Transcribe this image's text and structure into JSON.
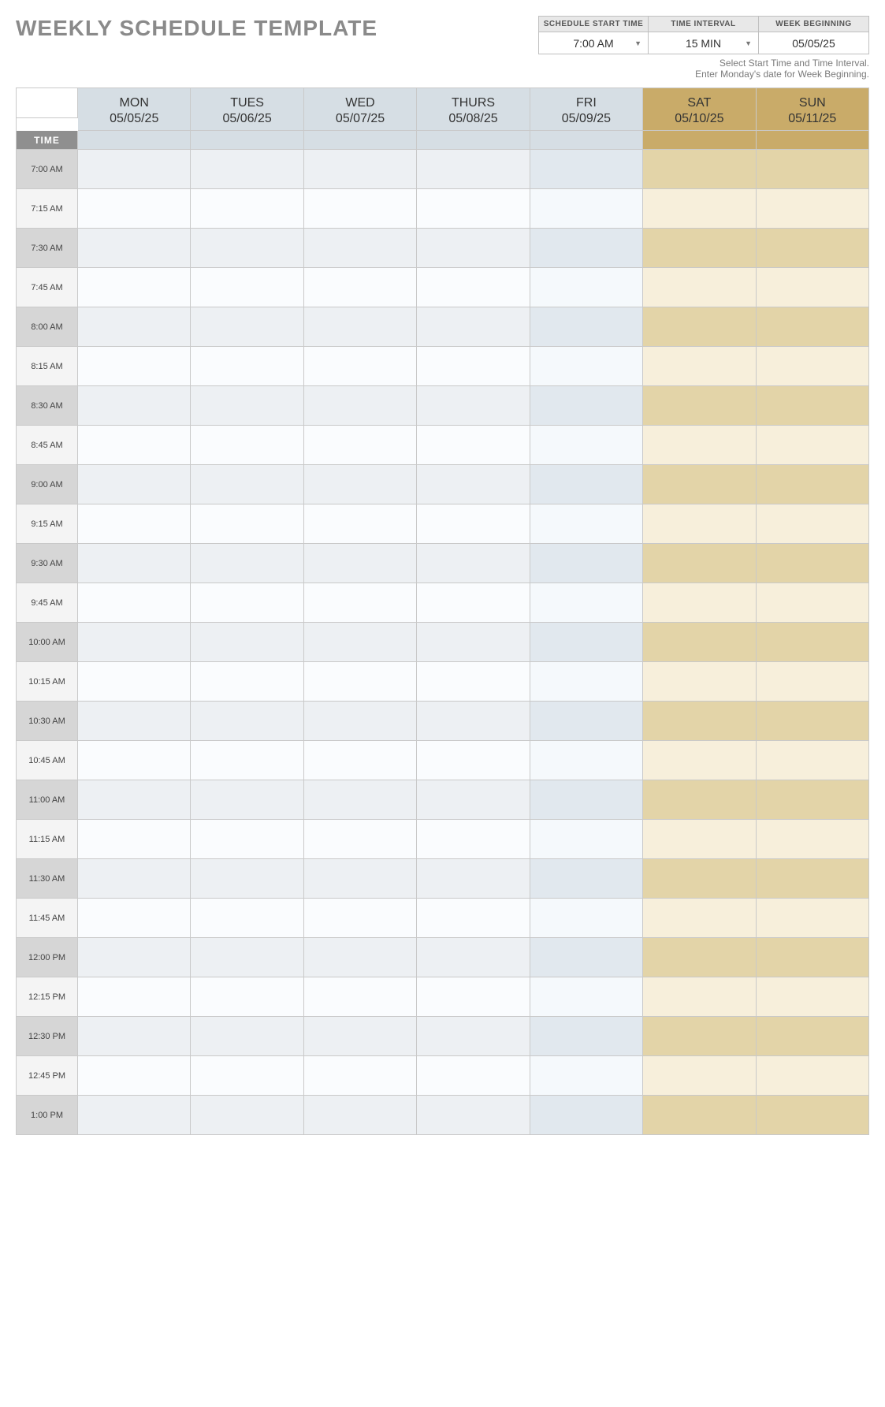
{
  "title": "WEEKLY SCHEDULE TEMPLATE",
  "subtitle_line1": "Select Start Time and Time Interval.",
  "subtitle_line2": "Enter Monday's date for Week Beginning.",
  "controls": {
    "start_time": {
      "label": "SCHEDULE START TIME",
      "value": "7:00 AM",
      "dropdown": true
    },
    "time_interval": {
      "label": "TIME INTERVAL",
      "value": "15 MIN",
      "dropdown": true
    },
    "week_begin": {
      "label": "WEEK BEGINNING",
      "value": "05/05/25",
      "dropdown": false
    }
  },
  "time_header_label": "TIME",
  "days": [
    {
      "name": "MON",
      "date": "05/05/25",
      "weekend": false,
      "friday": false
    },
    {
      "name": "TUES",
      "date": "05/06/25",
      "weekend": false,
      "friday": false
    },
    {
      "name": "WED",
      "date": "05/07/25",
      "weekend": false,
      "friday": false
    },
    {
      "name": "THURS",
      "date": "05/08/25",
      "weekend": false,
      "friday": false
    },
    {
      "name": "FRI",
      "date": "05/09/25",
      "weekend": false,
      "friday": true
    },
    {
      "name": "SAT",
      "date": "05/10/25",
      "weekend": true,
      "friday": false
    },
    {
      "name": "SUN",
      "date": "05/11/25",
      "weekend": true,
      "friday": false
    }
  ],
  "times": [
    {
      "label": "7:00 AM",
      "shaded": true
    },
    {
      "label": "7:15 AM",
      "shaded": false
    },
    {
      "label": "7:30 AM",
      "shaded": true
    },
    {
      "label": "7:45 AM",
      "shaded": false
    },
    {
      "label": "8:00 AM",
      "shaded": true
    },
    {
      "label": "8:15 AM",
      "shaded": false
    },
    {
      "label": "8:30 AM",
      "shaded": true
    },
    {
      "label": "8:45 AM",
      "shaded": false
    },
    {
      "label": "9:00 AM",
      "shaded": true
    },
    {
      "label": "9:15 AM",
      "shaded": false
    },
    {
      "label": "9:30 AM",
      "shaded": true
    },
    {
      "label": "9:45 AM",
      "shaded": false
    },
    {
      "label": "10:00 AM",
      "shaded": true
    },
    {
      "label": "10:15 AM",
      "shaded": false
    },
    {
      "label": "10:30 AM",
      "shaded": true
    },
    {
      "label": "10:45 AM",
      "shaded": false
    },
    {
      "label": "11:00 AM",
      "shaded": true
    },
    {
      "label": "11:15 AM",
      "shaded": false
    },
    {
      "label": "11:30 AM",
      "shaded": true
    },
    {
      "label": "11:45 AM",
      "shaded": false
    },
    {
      "label": "12:00 PM",
      "shaded": true
    },
    {
      "label": "12:15 PM",
      "shaded": false
    },
    {
      "label": "12:30 PM",
      "shaded": true
    },
    {
      "label": "12:45 PM",
      "shaded": false
    },
    {
      "label": "1:00 PM",
      "shaded": true
    }
  ]
}
